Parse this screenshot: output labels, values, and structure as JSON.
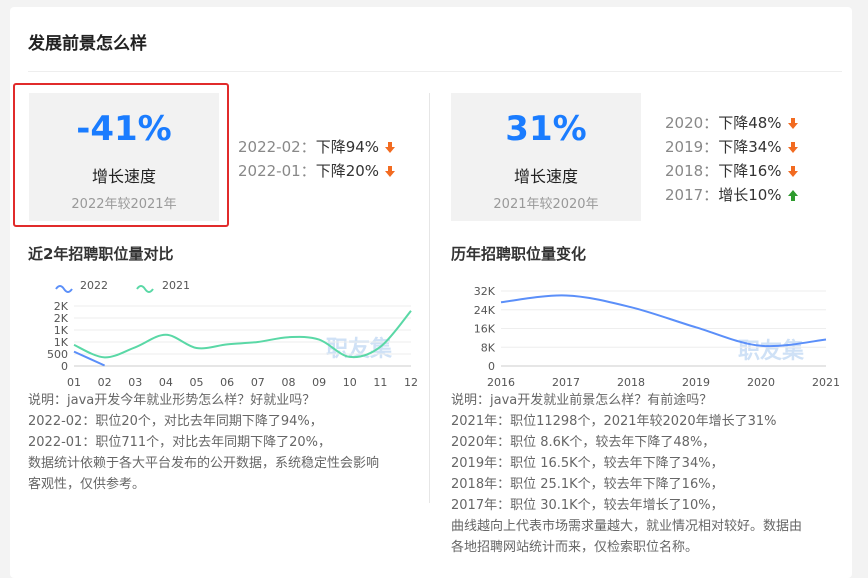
{
  "section_title": "发展前景怎么样",
  "left": {
    "stat": {
      "value": "-41%",
      "label": "增长速度",
      "sub": "2022年较2021年"
    },
    "trends": [
      {
        "period": "2022-02：",
        "text": "下降94%",
        "dir": "down"
      },
      {
        "period": "2022-01：",
        "text": "下降20%",
        "dir": "down"
      }
    ],
    "chart_title": "近2年招聘职位量对比",
    "desc": [
      "说明：java开发今年就业形势怎么样？好就业吗？",
      "2022-02：职位20个，对比去年同期下降了94%，",
      "2022-01：职位711个，对比去年同期下降了20%，",
      "数据统计依赖于各大平台发布的公开数据，系统稳定性会影响",
      "客观性，仅供参考。"
    ]
  },
  "right": {
    "stat": {
      "value": "31%",
      "label": "增长速度",
      "sub": "2021年较2020年"
    },
    "trends": [
      {
        "period": "2020：",
        "text": "下降48%",
        "dir": "down"
      },
      {
        "period": "2019：",
        "text": "下降34%",
        "dir": "down"
      },
      {
        "period": "2018：",
        "text": "下降16%",
        "dir": "down"
      },
      {
        "period": "2017：",
        "text": "增长10%",
        "dir": "up"
      }
    ],
    "chart_title": "历年招聘职位量变化",
    "desc": [
      "说明：java开发就业前景怎么样？有前途吗？",
      "2021年：职位11298个，2021年较2020年增长了31%",
      "2020年：职位 8.6K个，较去年下降了48%，",
      "2019年：职位 16.5K个，较去年下降了34%，",
      "2018年：职位 25.1K个，较去年下降了16%，",
      "2017年：职位 30.1K个，较去年增长了10%，",
      "曲线越向上代表市场需求量越大，就业情况相对较好。数据由",
      "各地招聘网站统计而来，仅检索职位名称。"
    ]
  },
  "watermark": "职友集",
  "colors": {
    "accent": "#1a7cff",
    "down": "#f26b21",
    "up": "#2e9b2e",
    "series_2022": "#5b8ff9",
    "series_2021": "#5ad8a6",
    "frame": "#e12b2b"
  },
  "chart_data": [
    {
      "type": "line",
      "title": "",
      "x": [
        "01",
        "02",
        "03",
        "04",
        "05",
        "06",
        "07",
        "08",
        "09",
        "10",
        "11",
        "12"
      ],
      "series": [
        {
          "name": "2022",
          "values": [
            600,
            20
          ]
        },
        {
          "name": "2021",
          "values": [
            880,
            360,
            780,
            1300,
            750,
            900,
            1000,
            1200,
            1100,
            380,
            800,
            2300
          ]
        }
      ],
      "yticks": [
        "0",
        "500",
        "1K",
        "1K",
        "2K",
        "2K"
      ],
      "ylim": [
        0,
        2500
      ],
      "legend": "top-left",
      "grid": true
    },
    {
      "type": "line",
      "title": "",
      "x": [
        "2016",
        "2017",
        "2018",
        "2019",
        "2020",
        "2021"
      ],
      "series": [
        {
          "values": [
            27200,
            30100,
            25100,
            16500,
            8600,
            11298
          ]
        }
      ],
      "yticks": [
        "0",
        "8K",
        "16K",
        "24K",
        "32K"
      ],
      "ylim": [
        0,
        32000
      ],
      "grid": true
    }
  ]
}
